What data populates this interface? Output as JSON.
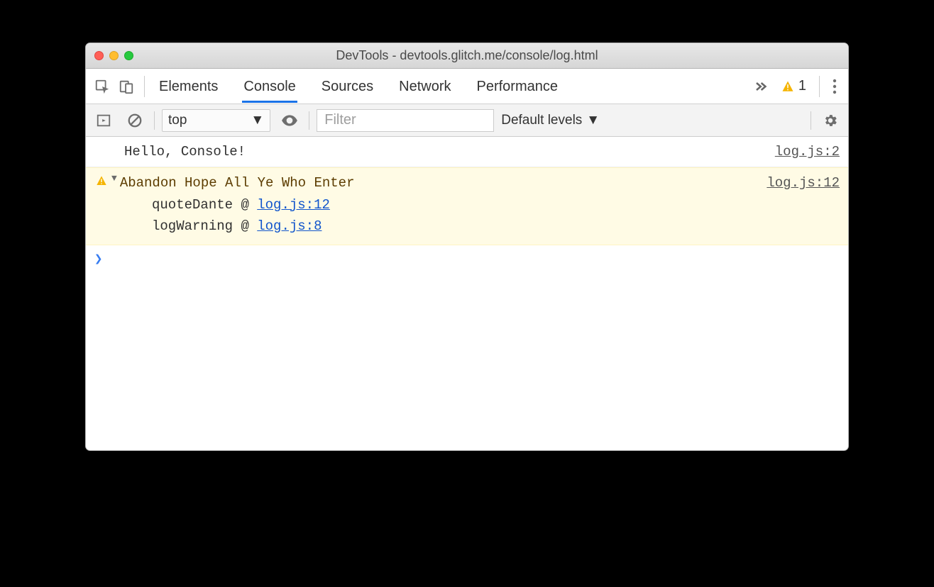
{
  "window": {
    "title": "DevTools - devtools.glitch.me/console/log.html"
  },
  "tabs": {
    "elements": "Elements",
    "console": "Console",
    "sources": "Sources",
    "network": "Network",
    "performance": "Performance"
  },
  "badge": {
    "warn_count": "1"
  },
  "toolbar": {
    "context": "top",
    "filter_placeholder": "Filter",
    "levels": "Default levels"
  },
  "messages": {
    "info": {
      "text": "Hello, Console!",
      "src": "log.js:2"
    },
    "warn": {
      "text": "Abandon Hope All Ye Who Enter",
      "src": "log.js:12",
      "stack": [
        {
          "fn": "quoteDante",
          "loc": "log.js:12"
        },
        {
          "fn": "logWarning",
          "loc": "log.js:8"
        }
      ]
    }
  }
}
